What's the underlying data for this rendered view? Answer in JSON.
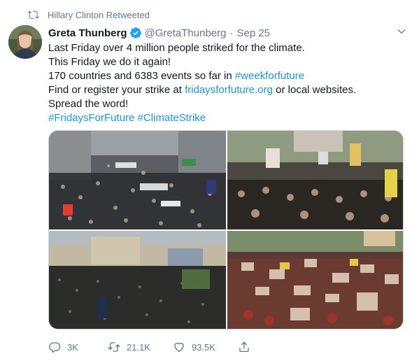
{
  "retweet_context": {
    "text": "Hillary Clinton Retweeted",
    "icon": "retweet-icon"
  },
  "author": {
    "name": "Greta Thunberg",
    "handle": "@GretaThunberg",
    "separator": "·",
    "date": "Sep 25",
    "verified": true
  },
  "tweet": {
    "line1": "Last Friday over 4 million people striked for the climate.",
    "line2": "This Friday we do it again!",
    "line3_text": "170 countries and 6383 events so far in ",
    "line3_hashtag": "#weekforfuture",
    "line4_text_before": "Find or register your strike at ",
    "line4_link": "fridaysforfuture.org",
    "line4_text_after": " or local websites.",
    "line5": "Spread the word!",
    "hashtag1": "#FridaysForFuture",
    "hashtag2": "#ClimateStrike"
  },
  "actions": {
    "replies": "3K",
    "retweets": "21.1K",
    "likes": "93.5K"
  },
  "colors": {
    "link": "#1b95e0",
    "verified": "#1da1f2",
    "muted": "#657786"
  }
}
